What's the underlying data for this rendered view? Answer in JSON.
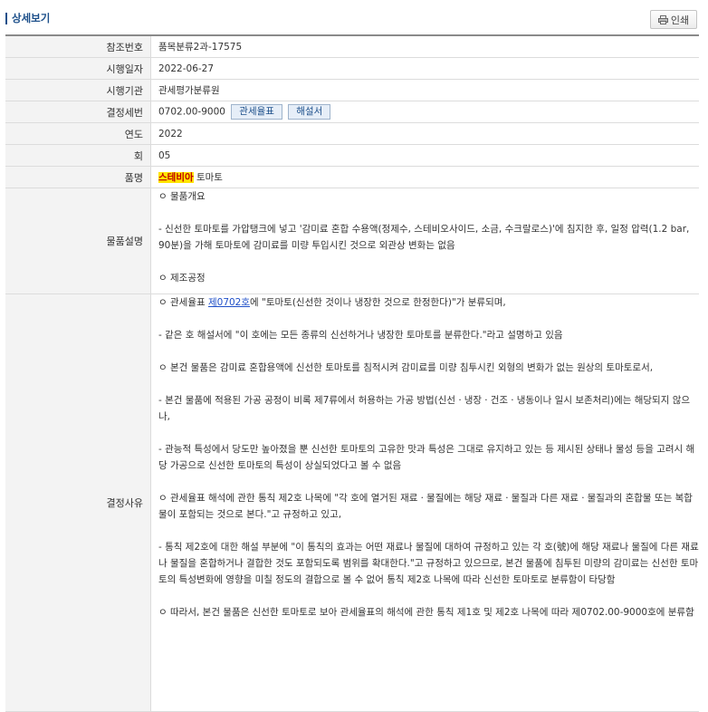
{
  "header": {
    "title": "상세보기",
    "print_label": "인쇄"
  },
  "fields": {
    "ref_no": {
      "label": "참조번호",
      "value": "품목분류2과-17575"
    },
    "date": {
      "label": "시행일자",
      "value": "2022-06-27"
    },
    "agency": {
      "label": "시행기관",
      "value": "관세평가분류원"
    },
    "hs": {
      "label": "결정세번",
      "value": "0702.00-9000",
      "btn1": "관세율표",
      "btn2": "해설서"
    },
    "year": {
      "label": "연도",
      "value": "2022"
    },
    "round": {
      "label": "회",
      "value": "05"
    },
    "name": {
      "label": "품명",
      "highlight": "스테비아",
      "rest": " 토마토"
    },
    "desc": {
      "label": "물품설명",
      "p1": "ㅇ 물품개요",
      "p2": "- 신선한 토마토를 가압탱크에 넣고 '감미료 혼합 수용액(정제수, 스테비오사이드, 소금, 수크랄로스)'에 침지한 후, 일정 압력(1.2 bar, 90분)을 가해 토마토에 감미료를 미량 투입시킨 것으로 외관상 변화는 없음",
      "p3": "ㅇ 제조공정"
    },
    "reason": {
      "label": "결정사유",
      "p1_pre": "ㅇ 관세율표 ",
      "p1_link": "제0702호",
      "p1_post": "에 \"토마토(신선한 것이나 냉장한 것으로 한정한다)\"가 분류되며,",
      "p2": "- 같은 호 해설서에 \"이 호에는 모든 종류의 신선하거나 냉장한 토마토를 분류한다.\"라고 설명하고 있음",
      "p3": "ㅇ 본건 물품은 감미료 혼합용액에 신선한 토마토를 침적시켜 감미료를 미량 침투시킨 외형의 변화가 없는 원상의 토마토로서,",
      "p4": "- 본건 물품에 적용된 가공 공정이 비록 제7류에서 허용하는 가공 방법(신선ㆍ냉장ㆍ건조ㆍ냉동이나 일시 보존처리)에는 해당되지 않으나,",
      "p5": "- 관능적 특성에서 당도만 높아졌을 뿐 신선한 토마토의 고유한 맛과 특성은 그대로 유지하고 있는 등 제시된 상태나 물성 등을 고려시 해당 가공으로 신선한 토마토의 특성이 상실되었다고 볼 수 없음",
      "p6": "ㅇ 관세율표 해석에 관한 통칙 제2호 나목에 \"각 호에 열거된 재료ㆍ물질에는 해당 재료ㆍ물질과 다른 재료ㆍ물질과의 혼합물 또는 복합물이 포함되는 것으로 본다.\"고 규정하고 있고,",
      "p7": "- 통칙 제2호에 대한 해설 부분에 \"이 통칙의 효과는 어떤 재료나 물질에 대하여 규정하고 있는 각 호(號)에 해당 재료나 물질에 다른 재료나 물질을 혼합하거나 결합한 것도 포함되도록 범위를 확대한다.\"고 규정하고 있으므로, 본건 물품에 침투된 미량의 감미료는 신선한 토마토의 특성변화에 영향을 미칠 정도의 결합으로 볼 수 없어 통칙 제2호 나목에 따라 신선한 토마토로 분류함이 타당함",
      "p8": "ㅇ 따라서, 본건 물품은 신선한 토마토로 보아 관세율표의 해석에 관한 통칙 제1호 및 제2호 나목에 따라 제0702.00-9000호에 분류함"
    }
  }
}
